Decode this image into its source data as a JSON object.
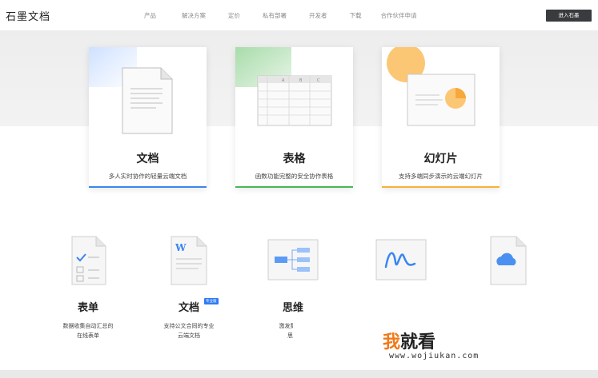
{
  "header": {
    "logo": "石墨文档",
    "nav": [
      "产品",
      "解决方案",
      "定价",
      "私有部署",
      "开发者",
      "下载",
      "合作伙伴申请"
    ],
    "cta": "进入石墨"
  },
  "products": [
    {
      "title": "文档",
      "desc": "多人实时协作的轻量云端文档",
      "accent": "#3a86f0"
    },
    {
      "title": "表格",
      "desc": "函数功能完整的安全协作表格",
      "accent": "#47b856"
    },
    {
      "title": "幻灯片",
      "desc": "支持多端同步演示的云端幻灯片",
      "accent": "#f7b23b"
    }
  ],
  "tools": [
    {
      "title": "表单",
      "desc1": "数据收集自动汇总的",
      "desc2": "在线表单"
    },
    {
      "title": "文档",
      "badge": "专业版",
      "desc1": "支持公文合同的专业",
      "desc2": "云端文档"
    },
    {
      "title": "思维",
      "desc1": "激发集体创",
      "desc2": "思维"
    },
    {
      "title": "",
      "desc1": "",
      "desc2": ""
    },
    {
      "title": "",
      "desc1": "",
      "desc2": ""
    }
  ],
  "watermark": {
    "brand_a": "我",
    "brand_b": "就看",
    "url": "www.wojiukan.com"
  }
}
